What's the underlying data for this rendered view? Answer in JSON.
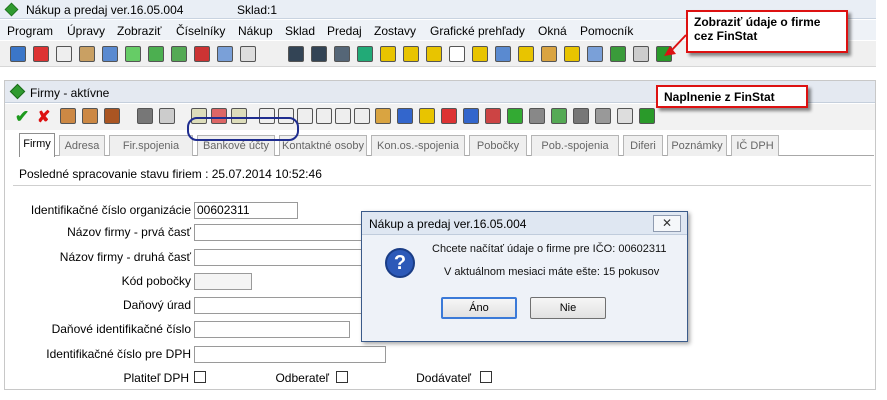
{
  "app": {
    "title": "Nákup a predaj ver.16.05.004",
    "store": "Sklad:1"
  },
  "menu": [
    "Program",
    "Úpravy",
    "Zobraziť",
    "Číselníky",
    "Nákup",
    "Sklad",
    "Predaj",
    "Zostavy",
    "Grafické prehľady",
    "Okná",
    "Pomocník"
  ],
  "callouts": {
    "finstat_show": "Zobraziť údaje o firme cez FinStat",
    "finstat_fill": "Naplnenie z FinStat"
  },
  "inner_window": {
    "title": "Firmy - aktívne"
  },
  "tabs": [
    "Firmy",
    "Adresa",
    "Fir.spojenia",
    "Bankové účty",
    "Kontaktné osoby",
    "Kon.os.-spojenia",
    "Pobočky",
    "Pob.-spojenia",
    "Diferi",
    "Poznámky",
    "IČ DPH"
  ],
  "status": "Posledné spracovanie stavu firiem : 25.07.2014 10:52:46",
  "form": {
    "ico_label": "Identifikačné číslo organizácie",
    "ico_value": "00602311",
    "name1_label": "Názov firmy - prvá časť",
    "name2_label": "Názov firmy - druhá časť",
    "branch_label": "Kód pobočky",
    "tax_office_label": "Daňový úrad",
    "dic_label": "Daňové identifikačné číslo",
    "icdph_label": "Identifikačné číslo pre DPH",
    "vat_payer_label": "Platiteľ DPH",
    "customer_label": "Odberateľ",
    "supplier_label": "Dodávateľ"
  },
  "dialog": {
    "title": "Nákup a predaj ver.16.05.004",
    "close": "✕",
    "question_icon": "?",
    "message1": "Chcete načítať údaje o firme pre IČO: 00602311",
    "message2": "V aktuálnom mesiaci máte ešte: 15 pokusov",
    "yes": "Áno",
    "no": "Nie"
  },
  "colors": {
    "accent_red": "#dd1111",
    "oval_blue": "#1f2d8f",
    "check_green": "#1d9a1d"
  }
}
